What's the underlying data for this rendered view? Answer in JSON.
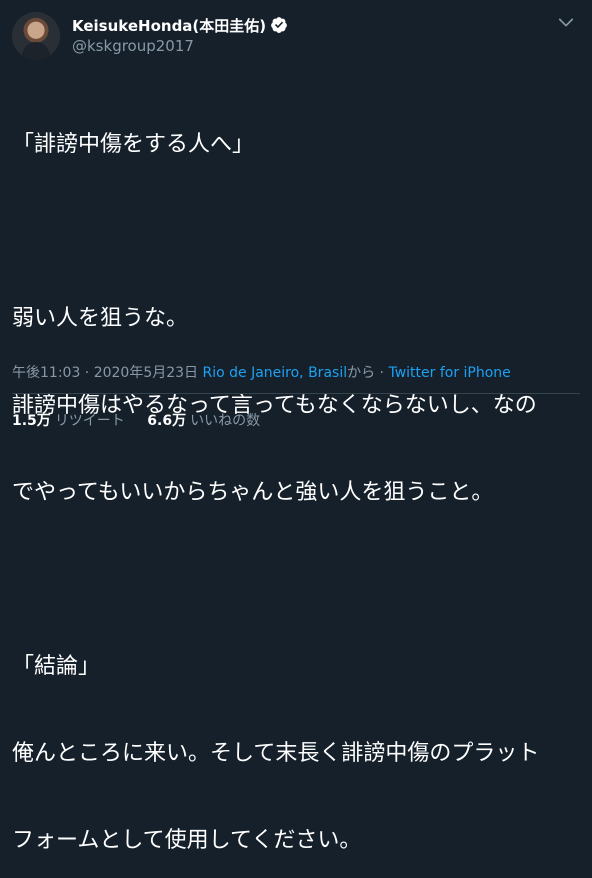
{
  "user": {
    "display_name": "KeisukeHonda(本田圭佑)",
    "handle": "@kskgroup2017"
  },
  "tweet": {
    "lines": [
      "「誹謗中傷をする人へ」",
      "",
      "弱い人を狙うな。",
      "誹謗中傷はやるなって言ってもなくならないし、なの",
      "でやってもいいからちゃんと強い人を狙うこと。",
      "",
      "「結論」",
      "俺んところに来い。そして末長く誹謗中傷のプラット",
      "フォームとして使用してください。"
    ],
    "time": "午後11:03 · 2020年5月23日",
    "location": "Rio de Janeiro, Brasil",
    "location_suffix": "から",
    "separator": " · ",
    "source": "Twitter for iPhone"
  },
  "stats": {
    "retweets_count": "1.5万",
    "retweets_label": "リツイート",
    "likes_count": "6.6万",
    "likes_label": "いいねの数"
  },
  "colors": {
    "background": "#15202b",
    "text": "#ffffff",
    "muted": "#8899a6",
    "link": "#1da1f2",
    "divider": "#38444d"
  },
  "icons": {
    "verified": "verified-badge-icon",
    "more": "chevron-down-icon"
  }
}
